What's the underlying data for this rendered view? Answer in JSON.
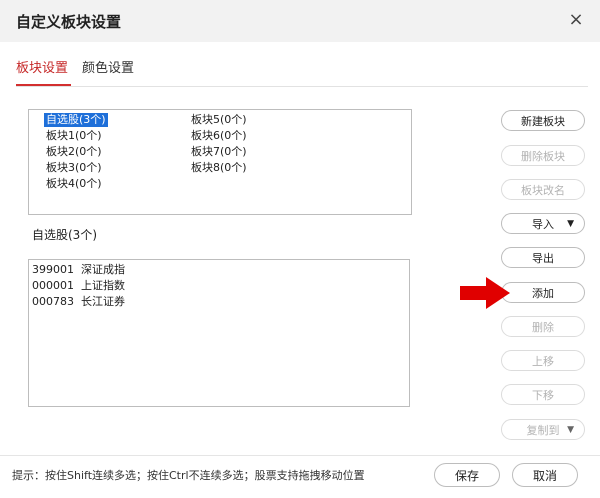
{
  "window": {
    "title": "自定义板块设置",
    "close_icon": "×"
  },
  "tabs": [
    {
      "label": "板块设置",
      "active": true
    },
    {
      "label": "颜色设置",
      "active": false
    }
  ],
  "boards": {
    "items": [
      {
        "label": "自选股(3个)",
        "selected": true
      },
      {
        "label": "板块1(0个)",
        "selected": false
      },
      {
        "label": "板块2(0个)",
        "selected": false
      },
      {
        "label": "板块3(0个)",
        "selected": false
      },
      {
        "label": "板块4(0个)",
        "selected": false
      },
      {
        "label": "板块5(0个)",
        "selected": false
      },
      {
        "label": "板块6(0个)",
        "selected": false
      },
      {
        "label": "板块7(0个)",
        "selected": false
      },
      {
        "label": "板块8(0个)",
        "selected": false
      }
    ]
  },
  "current_board_label": "自选股(3个)",
  "stocks": [
    {
      "code": "399001",
      "name": "深证成指"
    },
    {
      "code": "000001",
      "name": "上证指数"
    },
    {
      "code": "000783",
      "name": "长江证券"
    }
  ],
  "side_buttons": {
    "new_board": {
      "label": "新建板块",
      "enabled": true
    },
    "delete_board": {
      "label": "删除板块",
      "enabled": false
    },
    "rename_board": {
      "label": "板块改名",
      "enabled": false
    },
    "import": {
      "label": "导入",
      "enabled": true,
      "caret": "▼"
    },
    "export": {
      "label": "导出",
      "enabled": true
    },
    "add": {
      "label": "添加",
      "enabled": true
    },
    "delete": {
      "label": "删除",
      "enabled": false
    },
    "move_up": {
      "label": "上移",
      "enabled": false
    },
    "move_down": {
      "label": "下移",
      "enabled": false
    },
    "copy_to": {
      "label": "复制到",
      "enabled": false,
      "caret": "▼"
    }
  },
  "footer": {
    "hint": "提示：按住Shift连续多选；按住Ctrl不连续多选；股票支持拖拽移动位置",
    "save_label": "保存",
    "cancel_label": "取消"
  },
  "colors": {
    "accent": "#d32f2f",
    "selection": "#1e6fd9",
    "arrow": "#e00000"
  }
}
